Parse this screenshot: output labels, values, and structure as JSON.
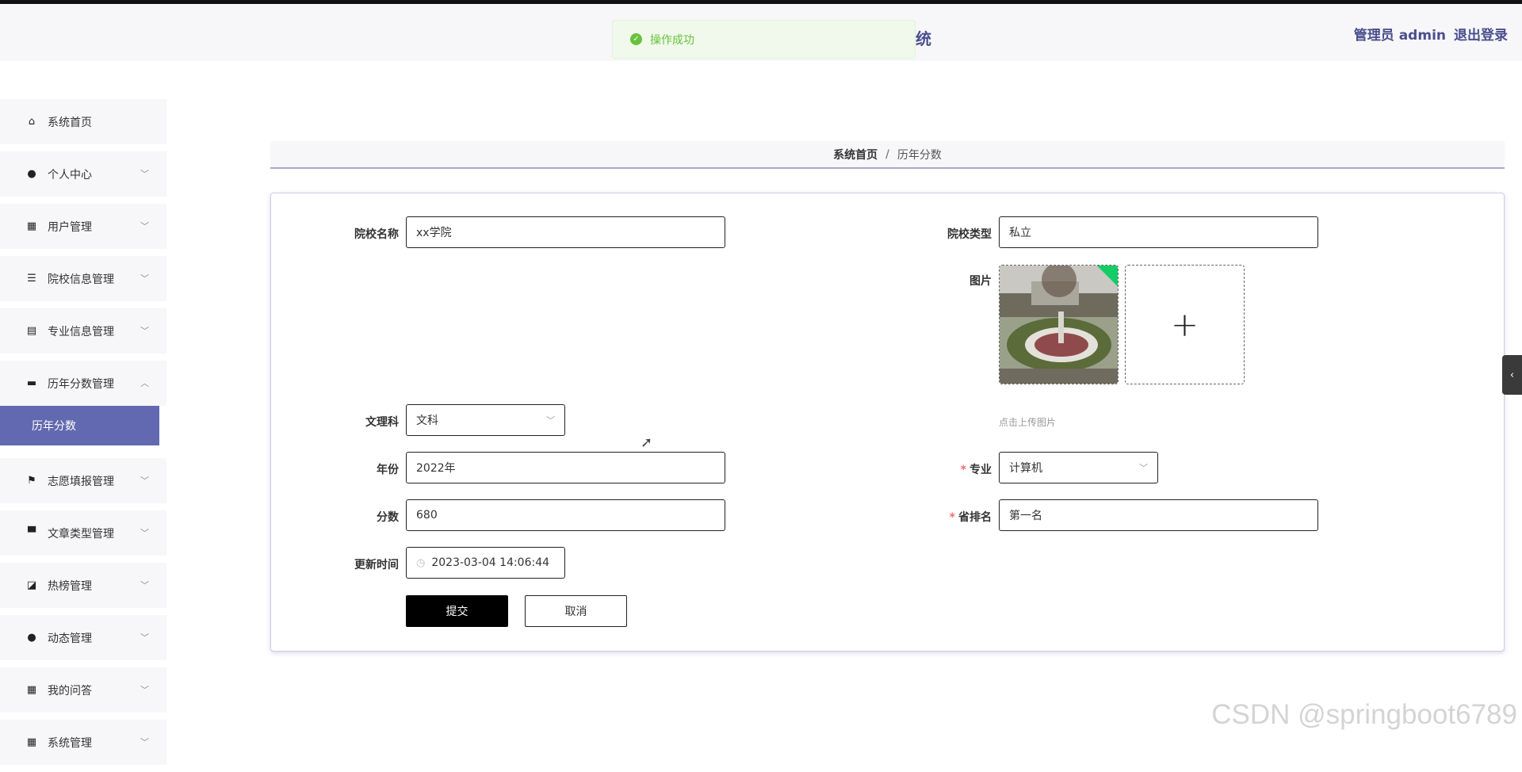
{
  "header": {
    "title_fragment": "统",
    "user_label": "管理员 admin",
    "logout_label": "退出登录"
  },
  "toast": {
    "message": "操作成功"
  },
  "sidebar": {
    "items": [
      {
        "label": "系统首页",
        "icon": "home-icon"
      },
      {
        "label": "个人中心",
        "icon": "user-icon"
      },
      {
        "label": "用户管理",
        "icon": "grid-icon"
      },
      {
        "label": "院校信息管理",
        "icon": "sliders-icon"
      },
      {
        "label": "专业信息管理",
        "icon": "clipboard-icon"
      },
      {
        "label": "历年分数管理",
        "icon": "briefcase-icon"
      },
      {
        "label": "志愿填报管理",
        "icon": "flag-icon"
      },
      {
        "label": "文章类型管理",
        "icon": "printer-icon"
      },
      {
        "label": "热榜管理",
        "icon": "chart-icon"
      },
      {
        "label": "动态管理",
        "icon": "user-icon"
      },
      {
        "label": "我的问答",
        "icon": "grid-icon"
      },
      {
        "label": "系统管理",
        "icon": "grid-icon"
      }
    ],
    "submenu": {
      "label": "历年分数"
    }
  },
  "breadcrumb": {
    "home": "系统首页",
    "separator": "/",
    "current": "历年分数"
  },
  "form": {
    "school_name": {
      "label": "院校名称",
      "value": "xx学院"
    },
    "school_type": {
      "label": "院校类型",
      "value": "私立"
    },
    "image": {
      "label": "图片",
      "tip": "点击上传图片"
    },
    "subject": {
      "label": "文理科",
      "value": "文科"
    },
    "year": {
      "label": "年份",
      "value": "2022年"
    },
    "major": {
      "label": "专业",
      "value": "计算机"
    },
    "score": {
      "label": "分数",
      "value": "680"
    },
    "rank": {
      "label": "省排名",
      "value": "第一名"
    },
    "update_time": {
      "label": "更新时间",
      "value": "2023-03-04 14:06:44"
    },
    "submit_label": "提交",
    "cancel_label": "取消"
  },
  "watermark": "CSDN @springboot6789",
  "colors": {
    "accent": "#6369b0",
    "header_text": "#4a4f8c",
    "success": "#67c23a",
    "required": "#f56c6c"
  }
}
